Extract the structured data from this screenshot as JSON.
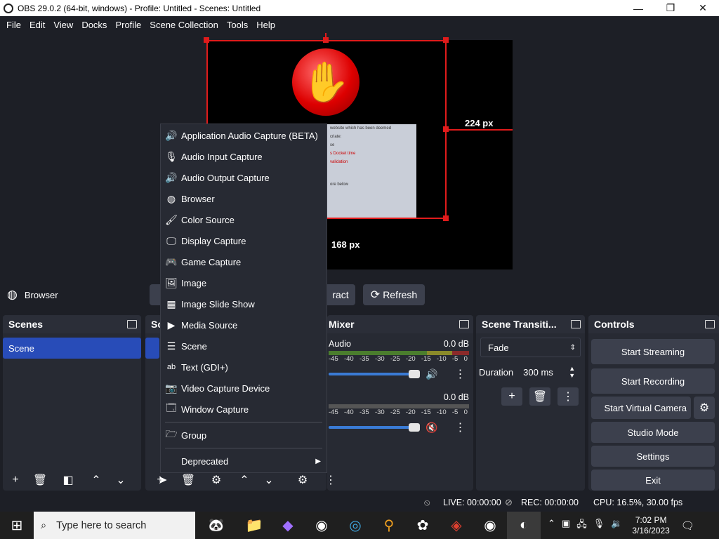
{
  "titlebar": {
    "title": "OBS 29.0.2 (64-bit, windows) - Profile: Untitled - Scenes: Untitled",
    "minimize": "—",
    "maximize": "❐",
    "close": "✕"
  },
  "menubar": [
    "File",
    "Edit",
    "View",
    "Docks",
    "Profile",
    "Scene Collection",
    "Tools",
    "Help"
  ],
  "preview": {
    "width_label": "224 px",
    "height_label": "168 px",
    "popup_lines": [
      "website which has been deemed",
      "criate:",
      "",
      "",
      "...",
      "",
      "se",
      "",
      "",
      "s Docket time",
      "validation",
      "",
      "",
      "",
      "ore below"
    ]
  },
  "source_toolbar": {
    "source_name": "Browser",
    "interact_label": "ract",
    "refresh_label": "Refresh"
  },
  "scenes_dock": {
    "title": "Scenes",
    "items": [
      "Scene"
    ]
  },
  "sources_dock": {
    "title": "So"
  },
  "mixer_dock": {
    "title": "Mixer",
    "channels": [
      {
        "name": "Audio",
        "level": "0.0 dB",
        "muted": false
      },
      {
        "name": "",
        "level": "0.0 dB",
        "muted": true
      }
    ],
    "scale": [
      "-45",
      "-40",
      "-35",
      "-30",
      "-25",
      "-20",
      "-15",
      "-10",
      "-5",
      "0"
    ]
  },
  "transitions_dock": {
    "title": "Scene Transiti...",
    "transition": "Fade",
    "duration_label": "Duration",
    "duration_value": "300 ms"
  },
  "controls_dock": {
    "title": "Controls",
    "start_streaming": "Start Streaming",
    "start_recording": "Start Recording",
    "start_virtual_camera": "Start Virtual Camera",
    "studio_mode": "Studio Mode",
    "settings": "Settings",
    "exit": "Exit"
  },
  "context_menu": {
    "items": [
      {
        "label": "Application Audio Capture (BETA)",
        "icon": "speaker-icon"
      },
      {
        "label": "Audio Input Capture",
        "icon": "microphone-icon"
      },
      {
        "label": "Audio Output Capture",
        "icon": "speaker-icon"
      },
      {
        "label": "Browser",
        "icon": "globe-icon"
      },
      {
        "label": "Color Source",
        "icon": "paintbrush-icon"
      },
      {
        "label": "Display Capture",
        "icon": "monitor-icon"
      },
      {
        "label": "Game Capture",
        "icon": "gamepad-icon"
      },
      {
        "label": "Image",
        "icon": "image-icon"
      },
      {
        "label": "Image Slide Show",
        "icon": "slideshow-icon"
      },
      {
        "label": "Media Source",
        "icon": "play-icon"
      },
      {
        "label": "Scene",
        "icon": "list-icon"
      },
      {
        "label": "Text (GDI+)",
        "icon": "text-icon"
      },
      {
        "label": "Video Capture Device",
        "icon": "camera-icon"
      },
      {
        "label": "Window Capture",
        "icon": "window-icon"
      }
    ],
    "group": "Group",
    "deprecated": "Deprecated"
  },
  "statusbar": {
    "live": "LIVE: 00:00:00",
    "rec": "REC: 00:00:00",
    "cpu": "CPU: 16.5%, 30.00 fps"
  },
  "taskbar": {
    "search_placeholder": "Type here to search",
    "time": "7:02 PM",
    "date": "3/16/2023"
  }
}
